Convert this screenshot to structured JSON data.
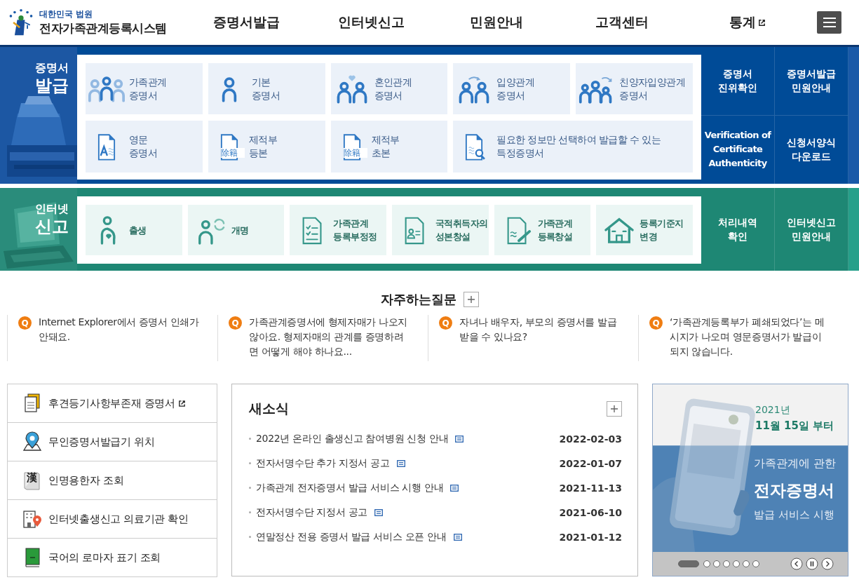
{
  "header": {
    "logo_top": "대한민국 법원",
    "logo_title": "전자가족관계등록시스템",
    "nav": [
      {
        "label": "증명서발급",
        "external": false
      },
      {
        "label": "인터넷신고",
        "external": false
      },
      {
        "label": "민원안내",
        "external": false
      },
      {
        "label": "고객센터",
        "external": false
      },
      {
        "label": "통계",
        "external": true
      }
    ]
  },
  "certificate_section": {
    "title_top": "증명서",
    "title_main": "발급",
    "cards": [
      {
        "text": "가족관계\n증명서"
      },
      {
        "text": "기본\n증명서"
      },
      {
        "text": "혼인관계\n증명서"
      },
      {
        "text": "입양관계\n증명서"
      },
      {
        "text": "친양자입양관계\n증명서"
      },
      {
        "text": "영문\n증명서"
      },
      {
        "text": "제적부\n등본",
        "icon_text": "除籍"
      },
      {
        "text": "제적부\n초본",
        "icon_text": "除籍"
      },
      {
        "text": "필요한 정보만 선택하여 발급할 수 있는\n특정증명서"
      }
    ],
    "links": [
      {
        "text": "증명서\n진위확인"
      },
      {
        "text": "증명서발급\n민원안내"
      },
      {
        "text": "Verification of\nCertificate\nAuthenticity"
      },
      {
        "text": "신청서양식\n다운로드"
      }
    ]
  },
  "report_section": {
    "title_top": "인터넷",
    "title_main": "신고",
    "cards": [
      {
        "text": "출생"
      },
      {
        "text": "개명"
      },
      {
        "text": "가족관계\n등록부정정"
      },
      {
        "text": "국적취득자의\n성본창설"
      },
      {
        "text": "가족관계\n등록창설"
      },
      {
        "text": "등록기준지\n변경"
      }
    ],
    "links": [
      {
        "text": "처리내역\n확인"
      },
      {
        "text": "인터넷신고\n민원안내"
      }
    ]
  },
  "faq": {
    "title": "자주하는질문",
    "items": [
      {
        "marker": "Q",
        "text": "Internet Explorer에서 증명서 인쇄가\n안돼요."
      },
      {
        "marker": "Q",
        "text": "가족관계증명서에 형제자매가 나오지\n않아요. 형제자매의 관계를 증명하려\n면 어떻게 해야 하나요..."
      },
      {
        "marker": "Q",
        "text": "자녀나 배우자, 부모의 증명서를 발급\n받을 수 있나요?"
      },
      {
        "marker": "Q",
        "text": "‘가족관계등록부가 폐쇄되었다’는 메\n시지가 나오며 영문증명서가 발급이\n되지 않습니다."
      }
    ]
  },
  "quick_links": [
    {
      "label": "후견등기사항부존재 증명서",
      "external": true
    },
    {
      "label": "무인증명서발급기 위치",
      "external": false
    },
    {
      "label": "인명용한자 조회",
      "external": false,
      "icon_text": "漢"
    },
    {
      "label": "인터넷출생신고 의료기관 확인",
      "external": false
    },
    {
      "label": "국어의 로마자 표기 조회",
      "external": false
    }
  ],
  "news": {
    "title": "새소식",
    "items": [
      {
        "title": "2022년 온라인 출생신고 참여병원 신청 안내",
        "date": "2022-02-03"
      },
      {
        "title": "전자서명수단 추가 지정서 공고",
        "date": "2022-01-07"
      },
      {
        "title": "가족관계 전자증명서 발급 서비스 시행 안내",
        "date": "2021-11-13"
      },
      {
        "title": "전자서명수단 지정서 공고",
        "date": "2021-06-10"
      },
      {
        "title": "연말정산 전용 증명서 발급 서비스 오픈 안내",
        "date": "2021-01-12"
      }
    ]
  },
  "banner": {
    "year": "2021년",
    "date": "11월 15일 부터",
    "line_1": "가족관계에 관한",
    "headline": "전자증명서",
    "line_3": "발급 서비스 시행",
    "slides": [
      {
        "selected": true
      },
      {
        "selected": false
      },
      {
        "selected": false
      },
      {
        "selected": false
      },
      {
        "selected": false
      },
      {
        "selected": false
      },
      {
        "selected": false
      }
    ]
  }
}
